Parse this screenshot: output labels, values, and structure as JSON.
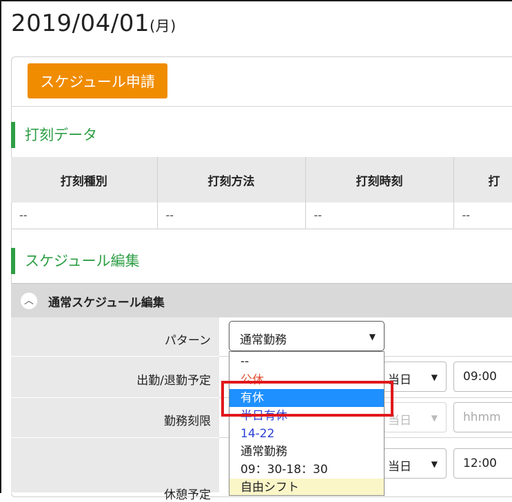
{
  "page": {
    "date": "2019/04/01",
    "day_of_week": "(月)"
  },
  "toolbar": {
    "schedule_request_label": "スケジュール申請"
  },
  "punch_section": {
    "title": "打刻データ",
    "columns": [
      "打刻種別",
      "打刻方法",
      "打刻時刻",
      "打"
    ],
    "rows": [
      [
        "--",
        "--",
        "--",
        "--"
      ]
    ]
  },
  "schedule_section": {
    "title": "スケジュール編集",
    "accordion_label": "通常スケジュール編集",
    "fields": {
      "pattern_label": "パターン",
      "attendance_label": "出勤/退勤予定",
      "work_limit_label": "勤務刻限",
      "break_label": "休憩予定"
    },
    "pattern_value": "通常勤務",
    "attendance_day": "当日",
    "attendance_time": "09:00",
    "work_limit_day": "当日",
    "work_limit_placeholder": "hhmm",
    "break_day": "当日",
    "break_time": "12:00"
  },
  "dropdown": {
    "options": [
      {
        "label": "--",
        "color": "#222222"
      },
      {
        "label": "公休",
        "color": "#e0533a"
      },
      {
        "label": "有休",
        "color": "#ffffff"
      },
      {
        "label": "半日有休",
        "color": "#2b3fd6"
      },
      {
        "label": "14-22",
        "color": "#2b3fd6"
      },
      {
        "label": "通常勤務",
        "color": "#222222"
      },
      {
        "label": "09：30-18：30",
        "color": "#222222"
      },
      {
        "label": "自由シフト",
        "color": "#222222"
      }
    ],
    "selected": "有休"
  },
  "colors": {
    "accent_orange": "#f08c00",
    "section_green": "#2e9e45",
    "selection_blue": "#1e90ff",
    "highlight_red": "#e0181b"
  }
}
